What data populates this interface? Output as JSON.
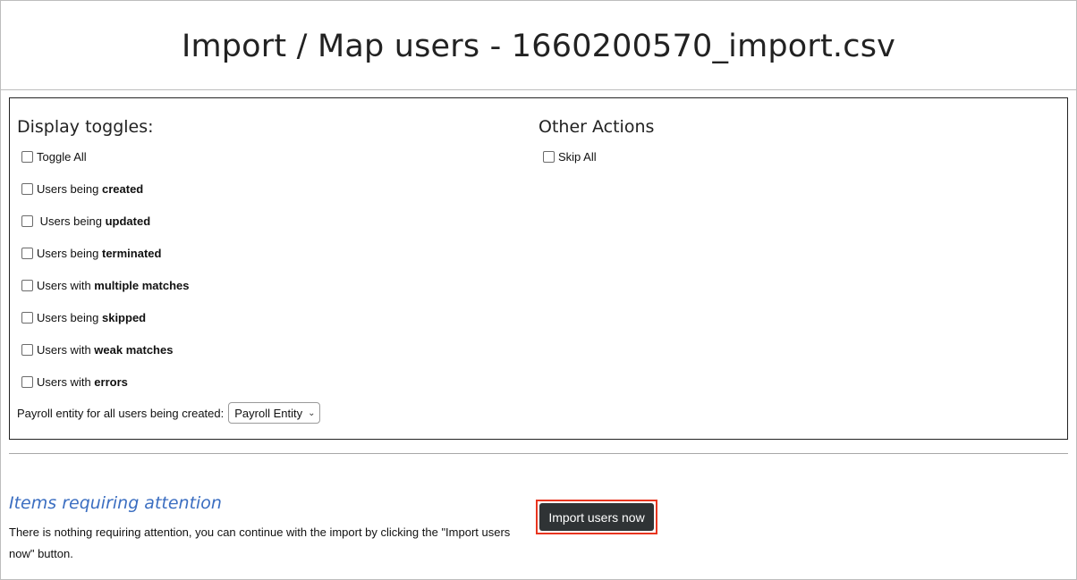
{
  "header": {
    "title": "Import / Map users - 1660200570_import.csv"
  },
  "display_toggles": {
    "heading": "Display toggles:",
    "items": [
      {
        "prefix": "Toggle All",
        "bold": ""
      },
      {
        "prefix": "Users being ",
        "bold": "created"
      },
      {
        "prefix": " Users being ",
        "bold": "updated"
      },
      {
        "prefix": "Users being ",
        "bold": "terminated"
      },
      {
        "prefix": "Users with ",
        "bold": "multiple matches"
      },
      {
        "prefix": "Users being ",
        "bold": "skipped"
      },
      {
        "prefix": "Users with ",
        "bold": "weak matches"
      },
      {
        "prefix": "Users with ",
        "bold": "errors"
      }
    ],
    "payroll_label": "Payroll entity for all users being created:",
    "payroll_selected": "Payroll Entity"
  },
  "other_actions": {
    "heading": "Other Actions",
    "skip_all_label": "Skip All"
  },
  "attention": {
    "title": "Items requiring attention",
    "text": "There is nothing requiring attention, you can continue with the import by clicking the \"Import users now\" button."
  },
  "import_button": {
    "label": "Import users now",
    "highlight_color": "#e8351f"
  }
}
